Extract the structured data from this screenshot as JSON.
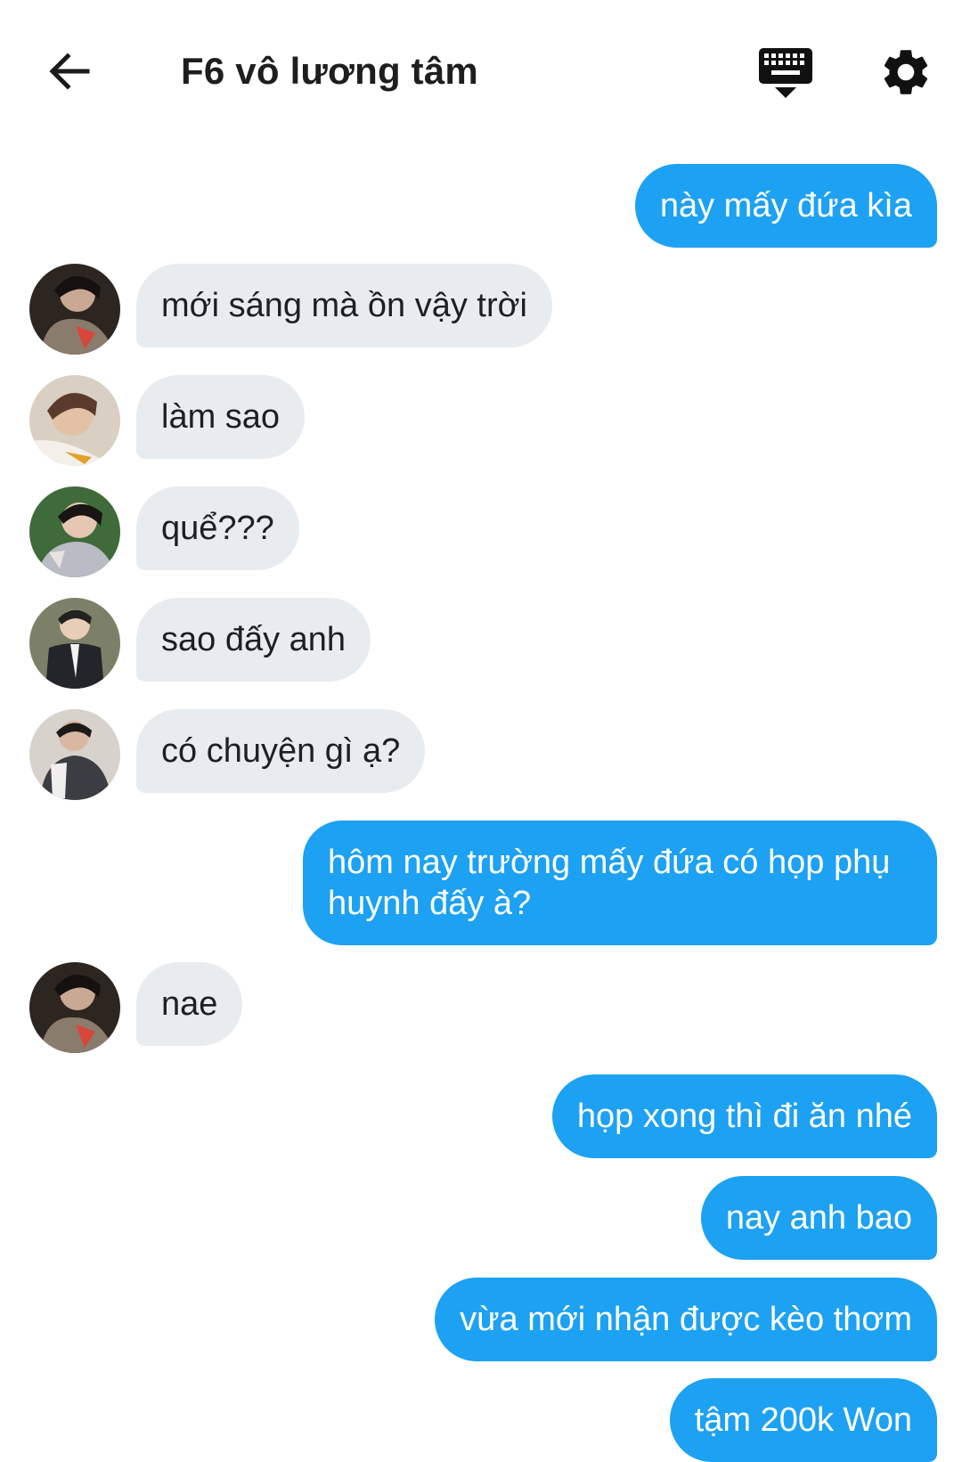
{
  "header": {
    "title": "F6 vô lương tâm",
    "back_icon": "arrow-left-icon",
    "keyboard_icon": "keyboard-icon",
    "settings_icon": "gear-icon"
  },
  "colors": {
    "outgoing_bubble": "#1da1f2",
    "incoming_bubble": "#e9ecef"
  },
  "messages": [
    {
      "side": "out",
      "text": "này mấy đứa kìa"
    },
    {
      "side": "in",
      "text": "mới sáng mà ồn vậy trời"
    },
    {
      "side": "in",
      "text": "làm sao"
    },
    {
      "side": "in",
      "text": "quể???"
    },
    {
      "side": "in",
      "text": "sao đấy anh"
    },
    {
      "side": "in",
      "text": "có chuyện gì ạ?"
    },
    {
      "side": "out",
      "text": "hôm nay trường mấy đứa có họp phụ huynh đấy à?"
    },
    {
      "side": "in",
      "text": "nae"
    },
    {
      "side": "out",
      "text": "họp xong thì đi ăn nhé"
    },
    {
      "side": "out",
      "text": "nay anh bao"
    },
    {
      "side": "out",
      "text": "vừa mới nhận được kèo thơm"
    },
    {
      "side": "out",
      "text": "tậm 200k Won"
    }
  ]
}
